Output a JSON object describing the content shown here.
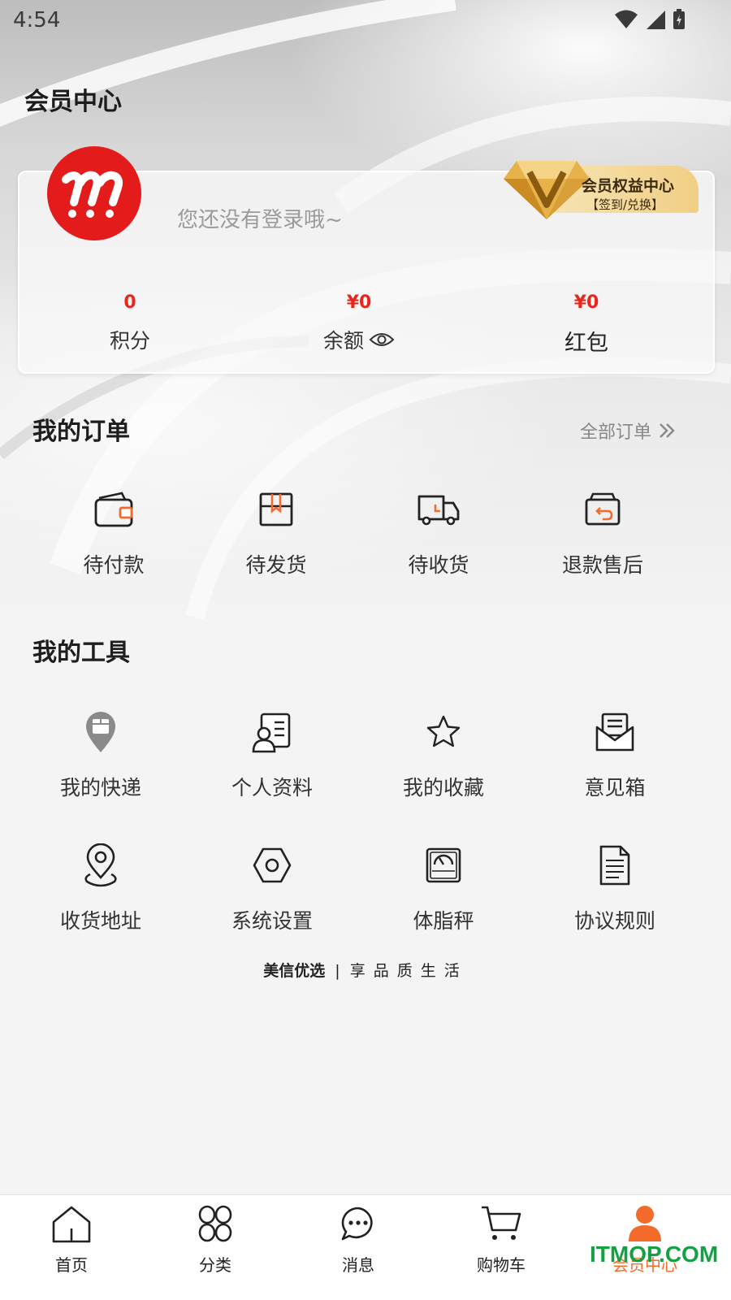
{
  "status_bar": {
    "time": "4:54"
  },
  "page_title": "会员中心",
  "member": {
    "login_prompt": "您还没有登录哦~",
    "vip_title": "会员权益中心",
    "vip_subtitle": "【签到/兑换】",
    "stats": [
      {
        "value": "0",
        "label": "积分"
      },
      {
        "value": "¥0",
        "label": "余额"
      },
      {
        "value": "¥0",
        "label": "红包"
      }
    ]
  },
  "orders": {
    "title": "我的订单",
    "all_label": "全部订单",
    "items": [
      {
        "label": "待付款",
        "icon": "wallet-icon"
      },
      {
        "label": "待发货",
        "icon": "package-icon"
      },
      {
        "label": "待收货",
        "icon": "delivery-truck-icon"
      },
      {
        "label": "退款售后",
        "icon": "refund-icon"
      }
    ]
  },
  "tools": {
    "title": "我的工具",
    "items": [
      {
        "label": "我的快递",
        "icon": "express-location-icon"
      },
      {
        "label": "个人资料",
        "icon": "profile-card-icon"
      },
      {
        "label": "我的收藏",
        "icon": "star-icon"
      },
      {
        "label": "意见箱",
        "icon": "mail-icon"
      },
      {
        "label": "收货地址",
        "icon": "location-pin-icon"
      },
      {
        "label": "系统设置",
        "icon": "settings-hex-icon"
      },
      {
        "label": "体脂秤",
        "icon": "scale-icon"
      },
      {
        "label": "协议规则",
        "icon": "document-icon"
      }
    ]
  },
  "slogan": {
    "brand": "美信优选",
    "tagline": "享品质生活"
  },
  "tabbar": {
    "items": [
      {
        "label": "首页",
        "icon": "home-icon"
      },
      {
        "label": "分类",
        "icon": "category-icon"
      },
      {
        "label": "消息",
        "icon": "message-icon"
      },
      {
        "label": "购物车",
        "icon": "cart-icon"
      },
      {
        "label": "会员中心",
        "icon": "user-icon",
        "active": true
      }
    ]
  },
  "watermark": "ITMOP.COM",
  "colors": {
    "accent": "#f26b2b",
    "price_red": "#e5271d",
    "brand_red": "#e41b1b",
    "gold": "#f1cf84"
  }
}
